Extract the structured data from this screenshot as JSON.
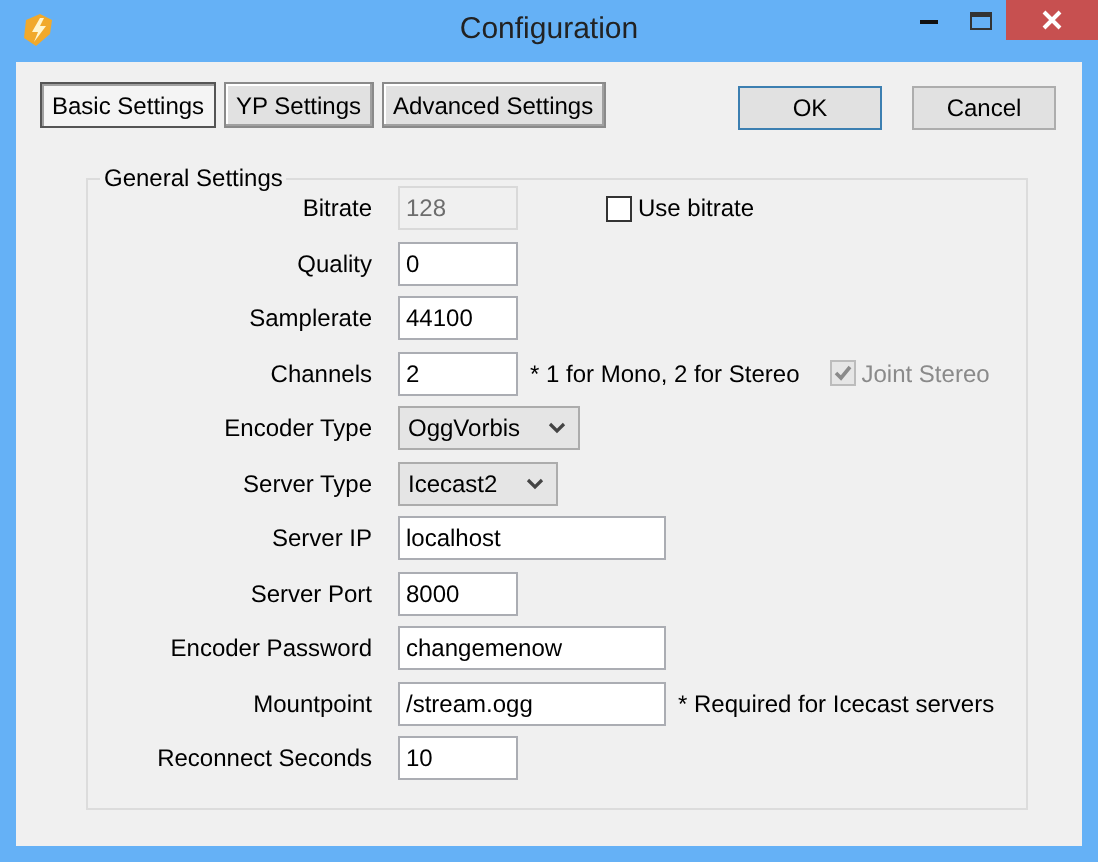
{
  "window": {
    "title": "Configuration"
  },
  "tabs": [
    {
      "label": "Basic Settings",
      "selected": true
    },
    {
      "label": "YP Settings",
      "selected": false
    },
    {
      "label": "Advanced Settings",
      "selected": false
    }
  ],
  "buttons": [
    {
      "label": "OK",
      "default": true
    },
    {
      "label": "Cancel",
      "default": false
    }
  ],
  "group": {
    "title": "General Settings",
    "rows": [
      {
        "label": "Bitrate",
        "kind": "short-field",
        "value": "128",
        "disabled": true,
        "checkbox": {
          "label": "Use bitrate",
          "checked": false,
          "disabled": false
        }
      },
      {
        "label": "Quality",
        "kind": "short-field",
        "value": "0",
        "disabled": false
      },
      {
        "label": "Samplerate",
        "kind": "short-field",
        "value": "44100",
        "disabled": false
      },
      {
        "label": "Channels",
        "kind": "short-field",
        "value": "2",
        "disabled": false,
        "note": "* 1 for Mono, 2 for Stereo",
        "checkbox": {
          "label": "Joint Stereo",
          "checked": true,
          "disabled": true
        }
      },
      {
        "label": "Encoder Type",
        "kind": "dropdown",
        "value": "OggVorbis"
      },
      {
        "label": "Server Type",
        "kind": "dropdown",
        "value": "Icecast2"
      },
      {
        "label": "Server IP",
        "kind": "long-field",
        "value": "localhost",
        "disabled": false
      },
      {
        "label": "Server Port",
        "kind": "short-field",
        "value": "8000",
        "disabled": false
      },
      {
        "label": "Encoder Password",
        "kind": "long-field",
        "value": "changemenow",
        "disabled": false
      },
      {
        "label": "Mountpoint",
        "kind": "long-field",
        "value": "/stream.ogg",
        "disabled": false,
        "note": "* Required for Icecast servers"
      },
      {
        "label": "Reconnect Seconds",
        "kind": "short-field",
        "value": "10",
        "disabled": false
      }
    ]
  }
}
